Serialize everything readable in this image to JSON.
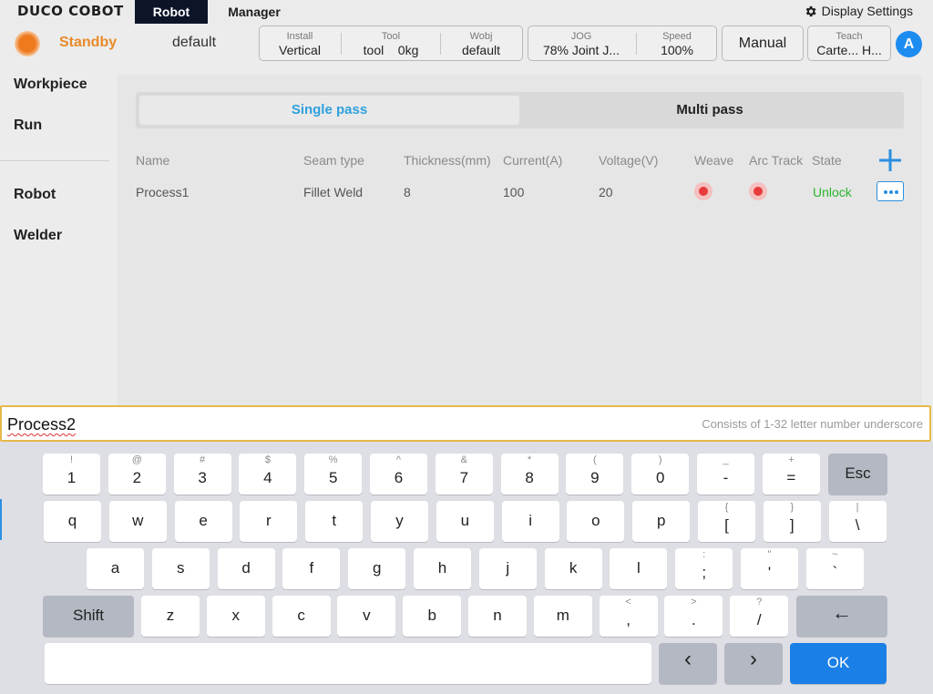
{
  "header": {
    "logo": "DUCO COBOT",
    "tabs": [
      {
        "label": "Robot",
        "active": true
      },
      {
        "label": "Manager",
        "active": false
      }
    ],
    "display_settings": "Display Settings"
  },
  "status": {
    "state": "Standby",
    "project": "default",
    "install": {
      "label": "Install",
      "value": "Vertical"
    },
    "tool": {
      "label": "Tool",
      "value": "tool",
      "mass": "0kg"
    },
    "wobj": {
      "label": "Wobj",
      "value": "default"
    },
    "jog": {
      "label": "JOG",
      "value": "78%  Joint J..."
    },
    "speed": {
      "label": "Speed",
      "value": "100%"
    },
    "mode": "Manual",
    "teach": {
      "label": "Teach",
      "value": "Carte...  H..."
    },
    "user_initial": "A"
  },
  "sidebar": {
    "items": [
      "Workpiece",
      "Run",
      "Robot",
      "Welder"
    ]
  },
  "main": {
    "tabs": [
      "Single pass",
      "Multi pass"
    ],
    "active_tab": "Single pass",
    "columns": [
      "Name",
      "Seam type",
      "Thickness(mm)",
      "Current(A)",
      "Voltage(V)",
      "Weave",
      "Arc Track",
      "State"
    ],
    "rows": [
      {
        "name": "Process1",
        "seam_type": "Fillet Weld",
        "thickness": "8",
        "current": "100",
        "voltage": "20",
        "weave": "on",
        "arc_track": "on",
        "state": "Unlock"
      }
    ]
  },
  "input": {
    "value": "Process2",
    "hint": "Consists of 1-32 letter number underscore"
  },
  "keyboard": {
    "row1": [
      [
        "!",
        "1"
      ],
      [
        "@",
        "2"
      ],
      [
        "#",
        "3"
      ],
      [
        "$",
        "4"
      ],
      [
        "%",
        "5"
      ],
      [
        "^",
        "6"
      ],
      [
        "&",
        "7"
      ],
      [
        "*",
        "8"
      ],
      [
        "(",
        "9"
      ],
      [
        ")",
        "0"
      ],
      [
        "_",
        "-"
      ],
      [
        "+",
        "="
      ]
    ],
    "esc": "Esc",
    "row2": [
      [
        "",
        "q"
      ],
      [
        "",
        "w"
      ],
      [
        "",
        "e"
      ],
      [
        "",
        "r"
      ],
      [
        "",
        "t"
      ],
      [
        "",
        "y"
      ],
      [
        "",
        "u"
      ],
      [
        "",
        "i"
      ],
      [
        "",
        "o"
      ],
      [
        "",
        "p"
      ],
      [
        "{",
        "["
      ],
      [
        "}",
        "]"
      ],
      [
        "|",
        "\\"
      ]
    ],
    "row3": [
      [
        "",
        "a"
      ],
      [
        "",
        "s"
      ],
      [
        "",
        "d"
      ],
      [
        "",
        "f"
      ],
      [
        "",
        "g"
      ],
      [
        "",
        "h"
      ],
      [
        "",
        "j"
      ],
      [
        "",
        "k"
      ],
      [
        "",
        "l"
      ],
      [
        ":",
        ";"
      ],
      [
        "\"",
        "'"
      ],
      [
        "~",
        "`"
      ]
    ],
    "shift": "Shift",
    "row4": [
      [
        "",
        "z"
      ],
      [
        "",
        "x"
      ],
      [
        "",
        "c"
      ],
      [
        "",
        "v"
      ],
      [
        "",
        "b"
      ],
      [
        "",
        "n"
      ],
      [
        "",
        "m"
      ],
      [
        "<",
        ","
      ],
      [
        ">",
        "."
      ],
      [
        "?",
        "/"
      ]
    ],
    "backspace": "←",
    "left": "‹",
    "right": "›",
    "ok": "OK"
  },
  "colors": {
    "accent": "#1a7fe6",
    "standby": "#e88a2a",
    "unlock": "#2bb52b",
    "active_tab": "#2ea1dc",
    "input_border": "#e6b94a"
  }
}
